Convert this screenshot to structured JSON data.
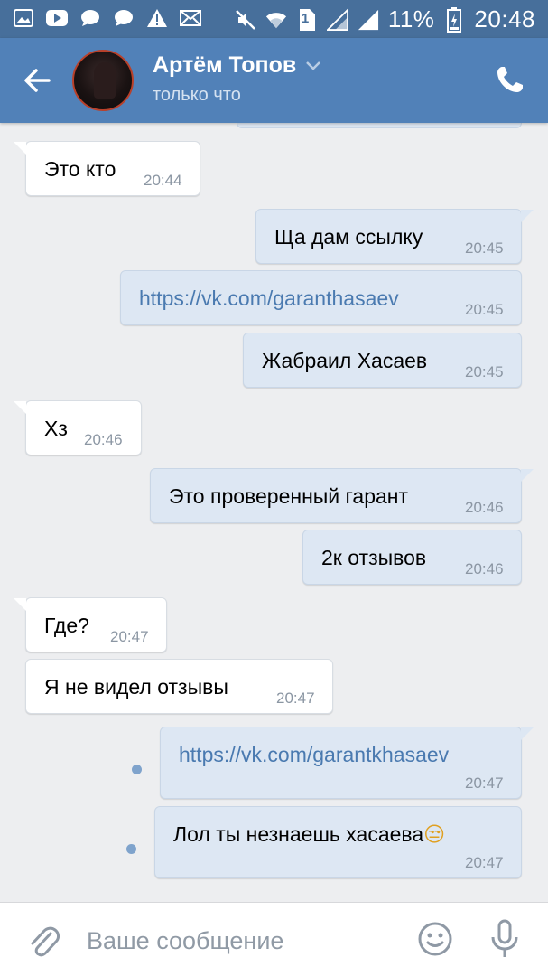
{
  "status_bar": {
    "battery": "11%",
    "time": "20:48",
    "sim": "1",
    "left_icons": [
      "gallery-icon",
      "youtube-icon",
      "chat-icon",
      "chat-icon",
      "warning-icon",
      "mail-icon"
    ],
    "right_icons": [
      "mute-icon",
      "wifi-icon",
      "sim-icon",
      "signal-icon",
      "signal-icon",
      "battery-icon"
    ]
  },
  "header": {
    "name": "Артём Топов",
    "status": "только что"
  },
  "messages": [
    {
      "dir": "in",
      "text": "Это кто",
      "time": "20:44"
    },
    {
      "dir": "out",
      "text": "Ща дам ссылку",
      "time": "20:45"
    },
    {
      "dir": "out",
      "text": "https://vk.com/garanthasaev",
      "time": "20:45",
      "link": true
    },
    {
      "dir": "out",
      "text": "Жабраил Хасаев",
      "time": "20:45"
    },
    {
      "dir": "in",
      "text": "Хз",
      "time": "20:46"
    },
    {
      "dir": "out",
      "text": "Это проверенный гарант",
      "time": "20:46"
    },
    {
      "dir": "out",
      "text": "2к отзывов",
      "time": "20:46"
    },
    {
      "dir": "in",
      "text": "Где?",
      "time": "20:47"
    },
    {
      "dir": "in",
      "text": "Я не видел отзывы",
      "time": "20:47"
    },
    {
      "dir": "out",
      "text": "https://vk.com/garantkhasaev",
      "time": "20:47",
      "link": true,
      "unread": true
    },
    {
      "dir": "out",
      "text": "Лол ты незнаешь хасаева",
      "time": "20:47",
      "emoji": "😒",
      "unread": true
    }
  ],
  "input": {
    "placeholder": "Ваше сообщение"
  },
  "colors": {
    "status_bar": "#476f9b",
    "header": "#5181b8",
    "chat_bg": "#edeef0",
    "bubble_in": "#ffffff",
    "bubble_out": "#dde7f3",
    "link": "#4a7ab0",
    "icon_grey": "#8f99a5"
  }
}
